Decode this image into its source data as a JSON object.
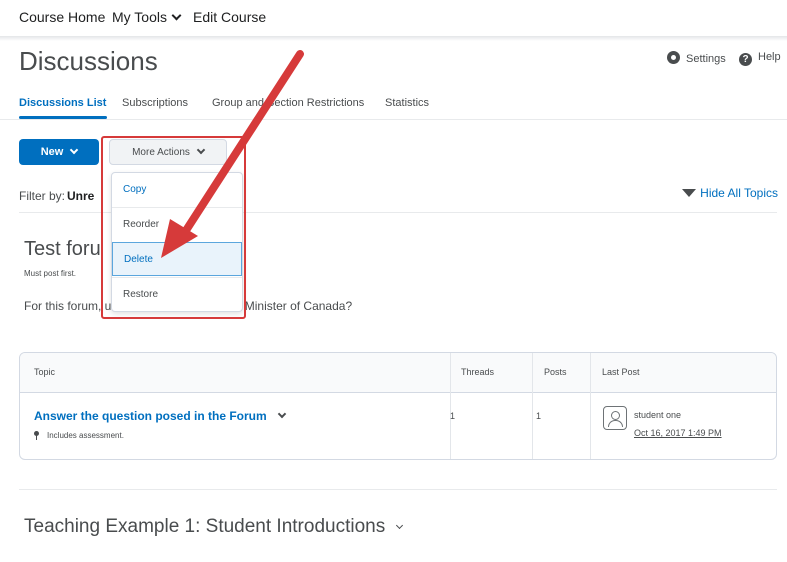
{
  "topnav": {
    "items": [
      "Course Home",
      "My Tools",
      "Edit Course"
    ]
  },
  "page": {
    "title": "Discussions",
    "settings_label": "Settings",
    "help_label": "Help"
  },
  "tabs": [
    "Discussions List",
    "Subscriptions",
    "Group and Section Restrictions",
    "Statistics"
  ],
  "toolbar": {
    "new_label": "New",
    "more_actions_label": "More Actions"
  },
  "menu": {
    "items": [
      "Copy",
      "Reorder",
      "Delete",
      "Restore"
    ],
    "highlighted": "Delete"
  },
  "filter": {
    "label": "Filter by:",
    "value": "Unre",
    "hide_topics_label": "Hide All Topics"
  },
  "forum": {
    "title": "Test foru",
    "subtitle": "Must post first.",
    "description": "For this forum,                             uestion:  Who is the Prime Minister of Canada?"
  },
  "table": {
    "headers": [
      "Topic",
      "Threads",
      "Posts",
      "Last Post"
    ],
    "rows": [
      {
        "topic": "Answer the question posed in the Forum",
        "note": "Includes assessment.",
        "threads": "1",
        "posts": "1",
        "last_post_user": "student one",
        "last_post_date": "Oct 16, 2017 1:49 PM"
      }
    ]
  },
  "second_forum": {
    "title": "Teaching Example 1: Student Introductions"
  },
  "colors": {
    "accent": "#006fbf",
    "annotation": "#d63a3a"
  },
  "icons": [
    "chevron-down-icon",
    "gear-icon",
    "help-icon",
    "triangle-down-icon",
    "pin-icon",
    "avatar-icon"
  ]
}
